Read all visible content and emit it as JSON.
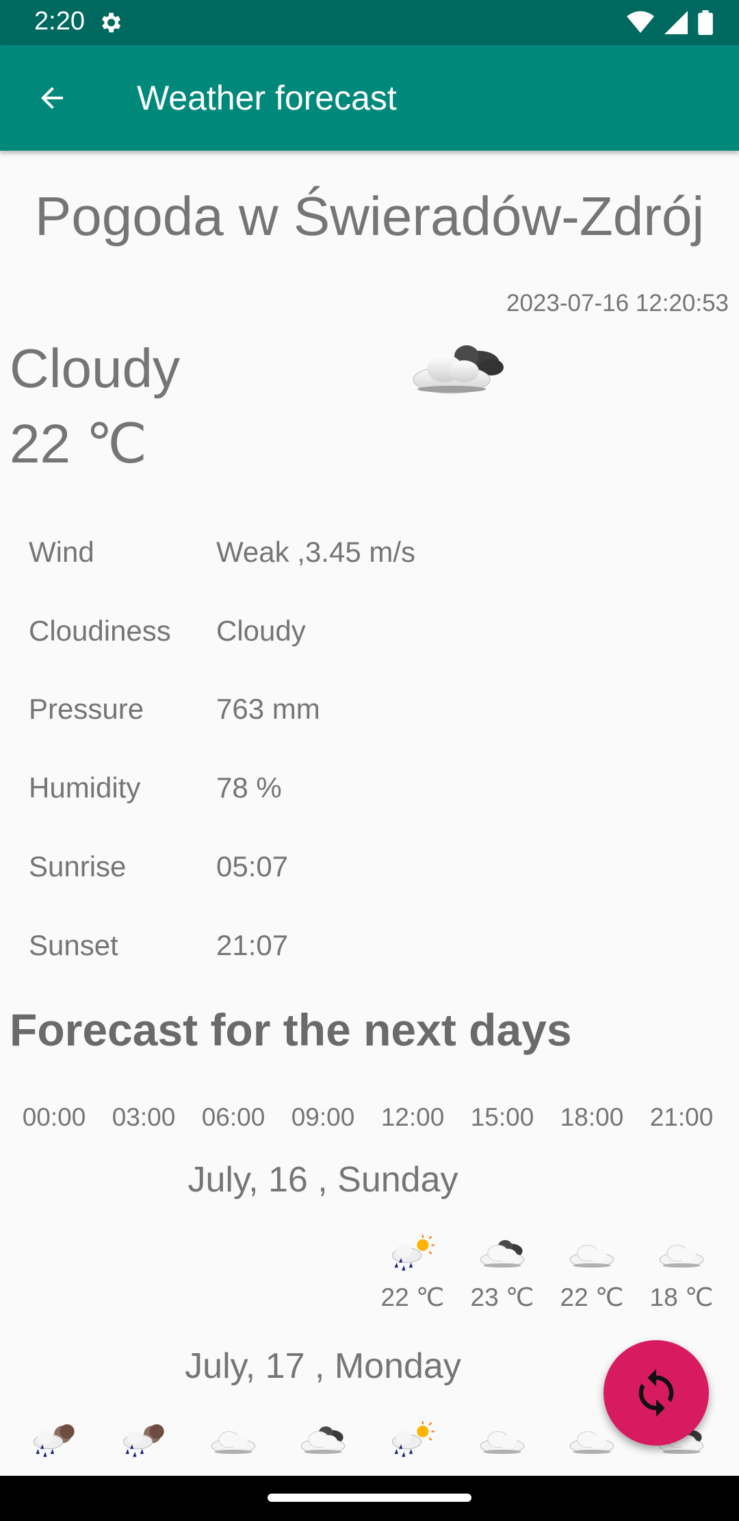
{
  "status_bar": {
    "time": "2:20"
  },
  "app_bar": {
    "title": "Weather forecast"
  },
  "current": {
    "city_title": "Pogoda w Świeradów-Zdrój",
    "timestamp": "2023-07-16 12:20:53",
    "condition": "Cloudy",
    "temperature": "22 ℃",
    "icon": "cloud-icon"
  },
  "details": [
    {
      "label": "Wind",
      "value": "Weak ,3.45 m/s"
    },
    {
      "label": "Cloudiness",
      "value": "Cloudy"
    },
    {
      "label": "Pressure",
      "value": "763 mm"
    },
    {
      "label": "Humidity",
      "value": "78 %"
    },
    {
      "label": "Sunrise",
      "value": "05:07"
    },
    {
      "label": "Sunset",
      "value": "21:07"
    }
  ],
  "forecast": {
    "heading": "Forecast for the next days",
    "hours": [
      "00:00",
      "03:00",
      "06:00",
      "09:00",
      "12:00",
      "15:00",
      "18:00",
      "21:00"
    ],
    "days": [
      {
        "label": "July, 16 , Sunday",
        "slots": [
          null,
          null,
          null,
          null,
          {
            "icon": "rain-sun-icon",
            "temp": "22 ℃"
          },
          {
            "icon": "cloud-dark-icon",
            "temp": "23 ℃"
          },
          {
            "icon": "cloud-icon",
            "temp": "22 ℃"
          },
          {
            "icon": "cloud-icon",
            "temp": "18 ℃"
          }
        ]
      },
      {
        "label": "July, 17 , Monday",
        "slots": [
          {
            "icon": "rain-moon-icon"
          },
          {
            "icon": "rain-moon-icon"
          },
          {
            "icon": "cloud-icon"
          },
          {
            "icon": "cloud-dark-icon"
          },
          {
            "icon": "rain-sun-icon"
          },
          {
            "icon": "cloud-icon"
          },
          {
            "icon": "cloud-icon"
          },
          {
            "icon": "cloud-dark-icon"
          }
        ]
      }
    ]
  },
  "fab": {
    "icon": "refresh-icon"
  },
  "colors": {
    "app_bar": "#00897b",
    "status_bar": "#00695f",
    "fab": "#d81b60",
    "text": "#757575"
  }
}
